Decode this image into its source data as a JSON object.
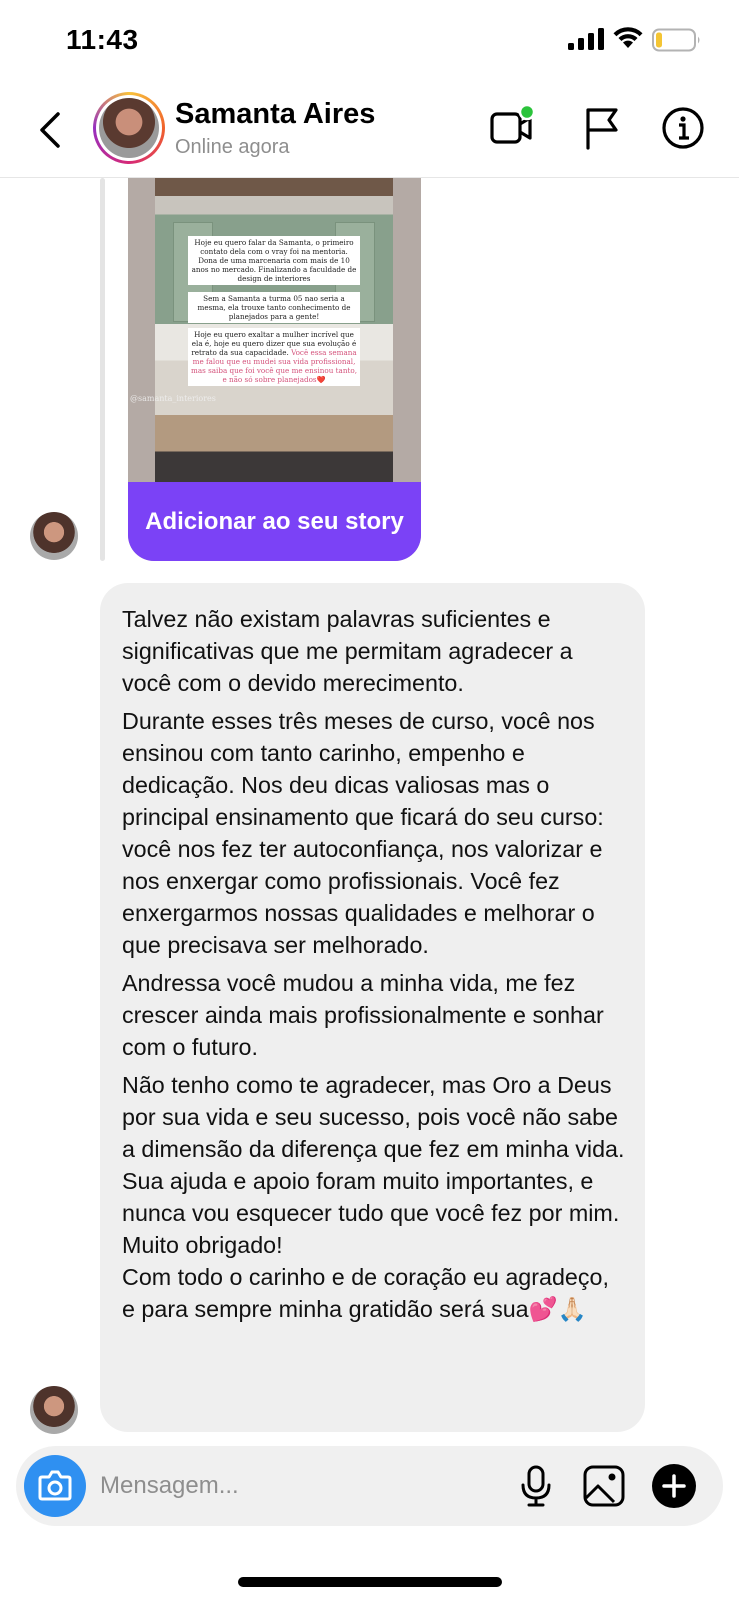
{
  "status_bar": {
    "time": "11:43"
  },
  "header": {
    "contact_name": "Samanta Aires",
    "contact_status": "Online agora",
    "icons": [
      "back-icon",
      "video-call-icon",
      "flag-icon",
      "info-icon"
    ]
  },
  "story": {
    "text_1": "Hoje eu quero falar da Samanta, o primeiro contato dela com o vray foi na mentoria. Dona de uma marcenaria com mais de 10 anos no mercado. Finalizando a faculdade de design de interiores",
    "text_2": "Sem a Samanta a turma 05 nao seria a mesma, ela trouxe tanto conhecimento de planejados para a gente!",
    "text_3_plain": "Hoje eu quero exaltar a mulher incrível que ela é, hoje eu quero dizer que sua evolução é retrato da sua capacidade.",
    "text_3_pink": "Você essa semana me falou que eu mudei sua vida profissional, mas saiba que foi você que me ensinou tanto, e não só sobre planejados❤️",
    "handle": "@samanta_interiores",
    "button_label": "Adicionar ao seu story"
  },
  "message": {
    "paragraphs": [
      "Talvez não existam palavras suficientes e significativas que me permitam agradecer a você com o devido merecimento.",
      "Durante esses três meses de curso, você nos ensinou com tanto carinho, empenho e dedicação. Nos deu dicas valiosas mas o principal ensinamento que ficará do seu curso: você nos fez ter autoconfiança, nos valorizar e nos enxergar como profissionais. Você fez enxergarmos nossas qualidades e melhorar o que precisava ser melhorado.",
      "Andressa você mudou a minha vida, me fez crescer ainda mais profissionalmente e sonhar com o futuro.",
      "Não tenho como te agradecer, mas Oro a Deus por sua vida e seu sucesso, pois você não sabe a dimensão da diferença que fez em minha vida.\nSua ajuda e apoio foram muito importantes, e nunca vou esquecer tudo que você fez por mim. Muito obrigado!\nCom todo o carinho e de coração eu agradeço, e para sempre minha gratidão será sua💕🙏🏻"
    ]
  },
  "composer": {
    "placeholder": "Mensagem...",
    "icons": [
      "camera-icon",
      "microphone-icon",
      "gallery-icon",
      "plus-icon"
    ]
  },
  "colors": {
    "accent_blue": "#2f90f1",
    "story_button": "#7b42f6",
    "online_dot": "#2bc33b",
    "bubble": "#efefef"
  }
}
